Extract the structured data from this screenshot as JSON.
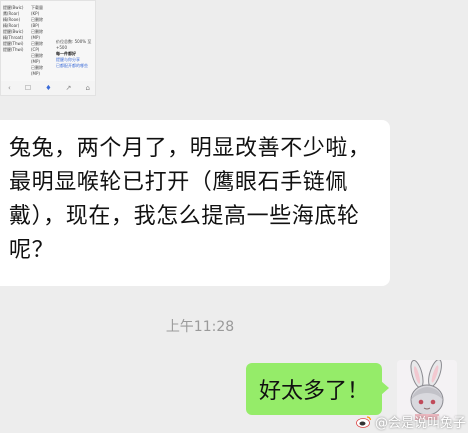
{
  "thumbnail": {
    "col1": [
      "提醒(Bwic)",
      "鹰(Roar)",
      "精(Rooe)",
      "精(Roar)",
      "提醒(Bwic)",
      "精(Throat)",
      "提醒(Thwi)",
      "提醒(Thwi)"
    ],
    "col2": [
      "下载量",
      "(KP)",
      "已删除",
      "(BP)",
      "已删除",
      "(MP)",
      "已删除",
      "(CP)",
      "已删除",
      "(MP)",
      "已删除",
      "(MP)"
    ],
    "col3": [
      "价位总数: 500% 至",
      "+500",
      "",
      "每一件都好",
      "",
      "提醒与你分享",
      "已都配开都的哪些"
    ],
    "toolbar": [
      "‹",
      "☐",
      "♦",
      "↗",
      "⌂"
    ]
  },
  "messages": [
    {
      "direction": "incoming",
      "text": "兔兔，两个月了，明显改善不少啦，最明显喉轮已打开（鹰眼石手链佩戴），现在，我怎么提高一些海底轮呢？"
    },
    {
      "direction": "outgoing",
      "text": "好太多了！"
    }
  ],
  "timestamp": "上午11:28",
  "watermark": "@会是说叫兔子",
  "colors": {
    "background": "#ededed",
    "incoming_bubble": "#ffffff",
    "outgoing_bubble": "#95ec69",
    "timestamp": "#9a9a9a"
  }
}
